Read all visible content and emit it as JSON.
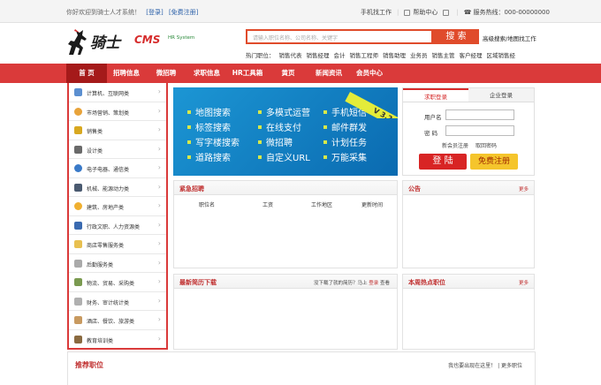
{
  "topbar": {
    "welcome": "你好欢迎到骑士人才系统！",
    "login": "[登录]",
    "register": "[免费注册]",
    "phone_work": "手机找工作",
    "help": "帮助中心",
    "hotline": "服务热线：000-00000000"
  },
  "logo": {
    "cn": "骑士",
    "cms": "CMS",
    "sub": "HR System"
  },
  "search": {
    "placeholder": "请输入职位名称、公司名称、关键字",
    "button": "搜 索",
    "advanced": "高级搜索/地图找工作"
  },
  "hot": {
    "label": "热门职位：",
    "items": [
      "销售代表",
      "销售经理",
      "会计",
      "销售工程师",
      "销售助理",
      "业务员",
      "销售主管",
      "客户经理",
      "区域销售经"
    ]
  },
  "nav": {
    "items": [
      "首 页",
      "招聘信息",
      "微招聘",
      "求职信息",
      "HR工具箱",
      "黄页",
      "新闻资讯",
      "会员中心"
    ]
  },
  "categories": [
    "计算机、互联网类",
    "市场营销、策划类",
    "销售类",
    "设计类",
    "电子电器、通信类",
    "机械、能源动力类",
    "建筑、房地产类",
    "行政文职、人力资源类",
    "商店零售服务类",
    "后勤服务类",
    "物流、贸易、采购类",
    "财务、审计统计类",
    "酒店、餐饮、旅游类",
    "教育培训类"
  ],
  "banner": {
    "features": [
      "地图搜索",
      "多模式运营",
      "手机短信",
      "标签搜索",
      "在线支付",
      "邮件群发",
      "写字楼搜索",
      "微招聘",
      "计划任务",
      "道路搜索",
      "自定义URL",
      "万能采集"
    ],
    "version": "V 3.2"
  },
  "login": {
    "tab1": "求职登录",
    "tab2": "企业登录",
    "username": "用户名",
    "password": "密 码",
    "register_link": "新会员注册",
    "forgot": "取回密码",
    "login_btn": "登 陆",
    "free_reg": "免费注册"
  },
  "urgent": {
    "title": "紧急招聘",
    "cols": [
      "职位名",
      "工资",
      "工作地区",
      "更新时间"
    ]
  },
  "notice": {
    "title": "公告",
    "more": "更多"
  },
  "resume": {
    "title": "最新简历下载",
    "hint": "没下载了就的简历？马上",
    "login": "登录",
    "view": "查看"
  },
  "hotjobs": {
    "title": "本周热点职位",
    "more": "更多"
  },
  "recommend": {
    "title": "推荐职位",
    "right": "我也要出现在这里！ | 更多职位"
  }
}
